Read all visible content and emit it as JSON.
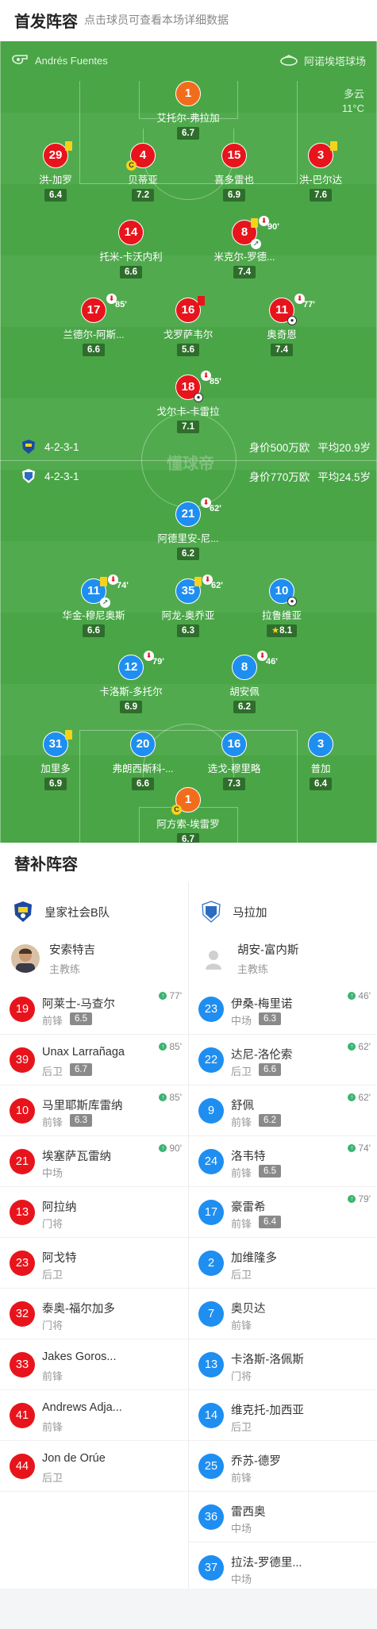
{
  "header": {
    "title": "首发阵容",
    "subtitle": "点击球员可查看本场详细数据"
  },
  "match": {
    "referee": "Andrés Fuentes",
    "stadium": "阿诺埃塔球场",
    "weather": "多云",
    "temperature": "11°C",
    "watermark": "懂球帝"
  },
  "home_team": {
    "name": "皇家社会B队",
    "formation": "4-2-3-1",
    "value": "身价500万欧",
    "avg_age": "平均20.9岁",
    "coach": "安索特吉",
    "coach_role": "主教练",
    "color": "#e8141c"
  },
  "away_team": {
    "name": "马拉加",
    "formation": "4-2-3-1",
    "value": "身价770万欧",
    "avg_age": "平均24.5岁",
    "coach": "胡安-富内斯",
    "coach_role": "主教练",
    "color": "#1f8ef1"
  },
  "home_lineup": [
    {
      "num": "1",
      "name": "艾托尔-弗拉加",
      "rating": "6.7"
    },
    {
      "num": "29",
      "name": "洪-加罗",
      "rating": "6.4"
    },
    {
      "num": "4",
      "name": "贝蒂亚",
      "rating": "7.2"
    },
    {
      "num": "15",
      "name": "喜多雷也",
      "rating": "6.9"
    },
    {
      "num": "3",
      "name": "洪-巴尔达",
      "rating": "7.6"
    },
    {
      "num": "14",
      "name": "托米-卡沃内利",
      "rating": "6.6"
    },
    {
      "num": "8",
      "name": "米克尔-罗德...",
      "rating": "7.4",
      "sub_min": "90'"
    },
    {
      "num": "17",
      "name": "兰德尔-阿斯...",
      "rating": "6.6",
      "sub_min": "85'"
    },
    {
      "num": "16",
      "name": "戈罗萨韦尔",
      "rating": "5.6"
    },
    {
      "num": "11",
      "name": "奥奇恩",
      "rating": "7.4",
      "sub_min": "77'"
    },
    {
      "num": "18",
      "name": "戈尔卡-卡雷拉",
      "rating": "7.1",
      "sub_min": "85'"
    }
  ],
  "away_lineup": [
    {
      "num": "21",
      "name": "阿德里安-尼...",
      "rating": "6.2",
      "sub_min": "62'"
    },
    {
      "num": "11",
      "name": "华金-穆尼奥斯",
      "rating": "6.6",
      "sub_min": "74'"
    },
    {
      "num": "35",
      "name": "阿龙-奥乔亚",
      "rating": "6.3",
      "sub_min": "62'"
    },
    {
      "num": "10",
      "name": "拉鲁维亚",
      "rating": "8.1"
    },
    {
      "num": "12",
      "name": "卡洛斯-多托尔",
      "rating": "6.9",
      "sub_min": "79'"
    },
    {
      "num": "8",
      "name": "胡安佩",
      "rating": "6.2",
      "sub_min": "46'"
    },
    {
      "num": "31",
      "name": "加里多",
      "rating": "6.9"
    },
    {
      "num": "20",
      "name": "弗朗西斯科-...",
      "rating": "6.6"
    },
    {
      "num": "16",
      "name": "选戈-穆里略",
      "rating": "7.3"
    },
    {
      "num": "3",
      "name": "普加",
      "rating": "6.4"
    },
    {
      "num": "1",
      "name": "阿方索-埃雷罗",
      "rating": "6.7"
    }
  ],
  "subs_header": "替补阵容",
  "home_subs": [
    {
      "num": "19",
      "name": "阿莱士-马查尔",
      "pos": "前锋",
      "rating": "6.5",
      "in": "77'"
    },
    {
      "num": "39",
      "name": "Unax Larrañaga",
      "pos": "后卫",
      "rating": "6.7",
      "in": "85'"
    },
    {
      "num": "10",
      "name": "马里耶斯库雷纳",
      "pos": "前锋",
      "rating": "6.3",
      "in": "85'"
    },
    {
      "num": "21",
      "name": "埃塞萨瓦雷纳",
      "pos": "中场",
      "rating": "",
      "in": "90'"
    },
    {
      "num": "13",
      "name": "阿拉纳",
      "pos": "门将",
      "rating": "",
      "in": ""
    },
    {
      "num": "23",
      "name": "阿戈特",
      "pos": "后卫",
      "rating": "",
      "in": ""
    },
    {
      "num": "32",
      "name": "泰奥-福尔加多",
      "pos": "门将",
      "rating": "",
      "in": ""
    },
    {
      "num": "33",
      "name": "Jakes Goros...",
      "pos": "前锋",
      "rating": "",
      "in": ""
    },
    {
      "num": "41",
      "name": "Andrews Adja...",
      "pos": "前锋",
      "rating": "",
      "in": ""
    },
    {
      "num": "44",
      "name": "Jon de Orúe",
      "pos": "后卫",
      "rating": "",
      "in": ""
    }
  ],
  "away_subs": [
    {
      "num": "23",
      "name": "伊桑-梅里诺",
      "pos": "中场",
      "rating": "6.3",
      "in": "46'"
    },
    {
      "num": "22",
      "name": "达尼-洛伦索",
      "pos": "后卫",
      "rating": "6.6",
      "in": "62'"
    },
    {
      "num": "9",
      "name": "舒佩",
      "pos": "前锋",
      "rating": "6.2",
      "in": "62'"
    },
    {
      "num": "24",
      "name": "洛韦特",
      "pos": "前锋",
      "rating": "6.5",
      "in": "74'"
    },
    {
      "num": "17",
      "name": "豪雷希",
      "pos": "前锋",
      "rating": "6.4",
      "in": "79'"
    },
    {
      "num": "2",
      "name": "加维隆多",
      "pos": "后卫",
      "rating": "",
      "in": ""
    },
    {
      "num": "7",
      "name": "奥贝达",
      "pos": "前锋",
      "rating": "",
      "in": ""
    },
    {
      "num": "13",
      "name": "卡洛斯-洛佩斯",
      "pos": "门将",
      "rating": "",
      "in": ""
    },
    {
      "num": "14",
      "name": "维克托-加西亚",
      "pos": "后卫",
      "rating": "",
      "in": ""
    },
    {
      "num": "25",
      "name": "乔苏-德罗",
      "pos": "前锋",
      "rating": "",
      "in": ""
    },
    {
      "num": "36",
      "name": "雷西奥",
      "pos": "中场",
      "rating": "",
      "in": ""
    },
    {
      "num": "37",
      "name": "拉法-罗德里...",
      "pos": "中场",
      "rating": "",
      "in": ""
    }
  ]
}
